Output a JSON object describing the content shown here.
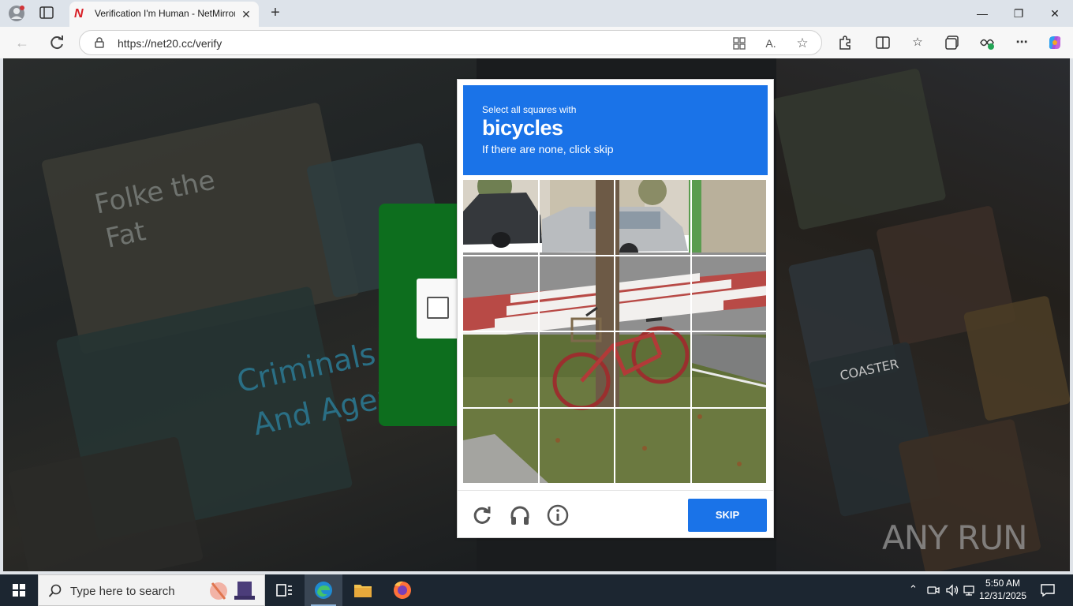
{
  "browser": {
    "tab_title": "Verification I'm Human - NetMirror",
    "tab_close": "✕",
    "new_tab": "+",
    "url": "https://net20.cc/verify",
    "window": {
      "minimize": "—",
      "restore": "❐",
      "close": "✕"
    }
  },
  "page": {
    "poster_texts": [
      "Folke the",
      "Fat",
      "Criminals",
      "And Agents",
      "COASTER"
    ]
  },
  "captcha": {
    "instruction": "Select all squares with",
    "keyword": "bicycles",
    "hint": "If there are none, click skip",
    "skip_label": "SKIP",
    "accent": "#1a73e8"
  },
  "watermark": {
    "text": "ANY RUN"
  },
  "taskbar": {
    "search_placeholder": "Type here to search",
    "time": "5:50 AM",
    "date": "12/31/2025"
  },
  "icons": {
    "reload": "reload-icon",
    "audio": "headphones-icon",
    "info": "info-icon"
  }
}
